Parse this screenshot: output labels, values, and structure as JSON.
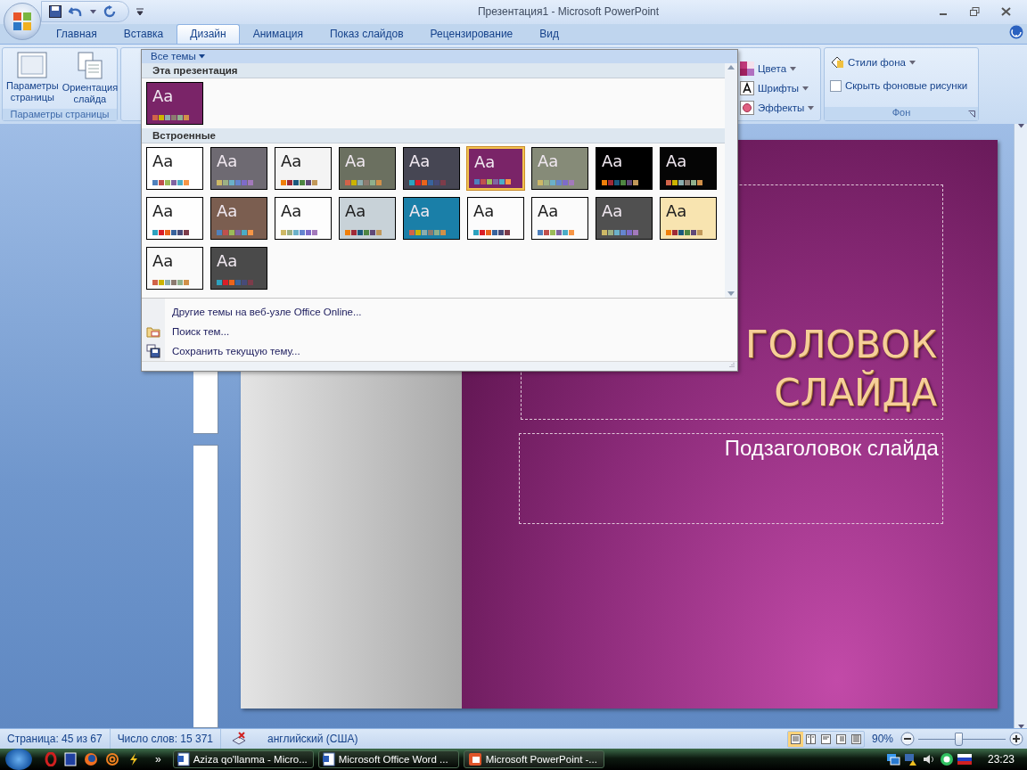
{
  "window": {
    "title": "Презентация1 - Microsoft PowerPoint"
  },
  "tabs": [
    {
      "label": "Главная",
      "selected": false
    },
    {
      "label": "Вставка",
      "selected": false
    },
    {
      "label": "Дизайн",
      "selected": true
    },
    {
      "label": "Анимация",
      "selected": false
    },
    {
      "label": "Показ слайдов",
      "selected": false
    },
    {
      "label": "Рецензирование",
      "selected": false
    },
    {
      "label": "Вид",
      "selected": false
    }
  ],
  "ribbon": {
    "page_group": {
      "buttons": [
        {
          "kind": "page",
          "label": "Параметры страницы"
        },
        {
          "kind": "orientation",
          "label": "Ориентация слайда"
        }
      ],
      "label": "Параметры страницы"
    },
    "theme_buttons": [
      {
        "kind": "colors",
        "label": "Цвета"
      },
      {
        "kind": "fonts",
        "label": "Шрифты"
      },
      {
        "kind": "effects",
        "label": "Эффекты"
      }
    ],
    "background_group": {
      "styles_button": "Стили фона",
      "hide_checkbox": {
        "label": "Скрыть фоновые рисунки",
        "checked": false
      },
      "label": "Фон"
    }
  },
  "gallery": {
    "filter": "Все темы",
    "this_title": "Эта презентация",
    "this": [
      {
        "label": "Aa",
        "selected": false,
        "color": "#7a2468"
      }
    ],
    "builtin_title": "Встроенные",
    "builtin": [
      {
        "label": "Aa",
        "selected": false,
        "color": "#ffffff"
      },
      {
        "label": "Aa",
        "selected": false,
        "color": "#6e6a72"
      },
      {
        "label": "Aa",
        "selected": false,
        "color": "#f4f4f4"
      },
      {
        "label": "Aa",
        "selected": false,
        "color": "#6b7060"
      },
      {
        "label": "Aa",
        "selected": false,
        "color": "#464653"
      },
      {
        "label": "Aa",
        "selected": true,
        "color": "#7a2468"
      },
      {
        "label": "Aa",
        "selected": false,
        "color": "#868b78"
      },
      {
        "label": "Aa",
        "selected": false,
        "color": "#000000"
      },
      {
        "label": "Aa",
        "selected": false,
        "color": "#050505"
      },
      {
        "label": "Aa",
        "selected": false,
        "color": "#fefefe"
      },
      {
        "label": "Aa",
        "selected": false,
        "color": "#7b5e50"
      },
      {
        "label": "Aa",
        "selected": false,
        "color": "#fdfdfd"
      },
      {
        "label": "Aa",
        "selected": false,
        "color": "#c8d2d8"
      },
      {
        "label": "Aa",
        "selected": false,
        "color": "#1a7fa8"
      },
      {
        "label": "Aa",
        "selected": false,
        "color": "#fcfcfc"
      },
      {
        "label": "Aa",
        "selected": false,
        "color": "#fbfbfb"
      },
      {
        "label": "Aa",
        "selected": false,
        "color": "#505050"
      },
      {
        "label": "Aa",
        "selected": false,
        "color": "#f8e4b0"
      },
      {
        "label": "Aa",
        "selected": false,
        "color": "#fafafa"
      },
      {
        "label": "Aa",
        "selected": false,
        "color": "#4a4a4a"
      }
    ],
    "menu": [
      {
        "kind": "link",
        "label": "Другие темы на веб-узле Office Online..."
      },
      {
        "kind": "browse",
        "label": "Поиск тем..."
      },
      {
        "kind": "save",
        "label": "Сохранить текущую тему..."
      }
    ]
  },
  "slide": {
    "title_lines": [
      "ГОЛОВОК",
      "СЛАЙДА"
    ],
    "subtitle": "Подзаголовок слайда"
  },
  "status_bar": {
    "page": "Страница: 45 из 67",
    "words": "Число слов: 15 371",
    "language": "английский (США)",
    "views": [
      {
        "selected": true
      },
      {
        "selected": false
      },
      {
        "selected": false
      },
      {
        "selected": false
      },
      {
        "selected": false
      }
    ],
    "zoom": "90%",
    "zoom_slider": {
      "level": 0.45
    }
  },
  "taskbar": {
    "tasks": [
      {
        "kind": "word",
        "label": "Aziza qo'llanma - Micro...",
        "selected": false
      },
      {
        "kind": "word",
        "label": "Microsoft Office Word ...",
        "selected": false
      },
      {
        "kind": "powerpoint",
        "label": "Microsoft PowerPoint -...",
        "selected": true
      }
    ],
    "overflow": "»",
    "clock": "23:23"
  }
}
